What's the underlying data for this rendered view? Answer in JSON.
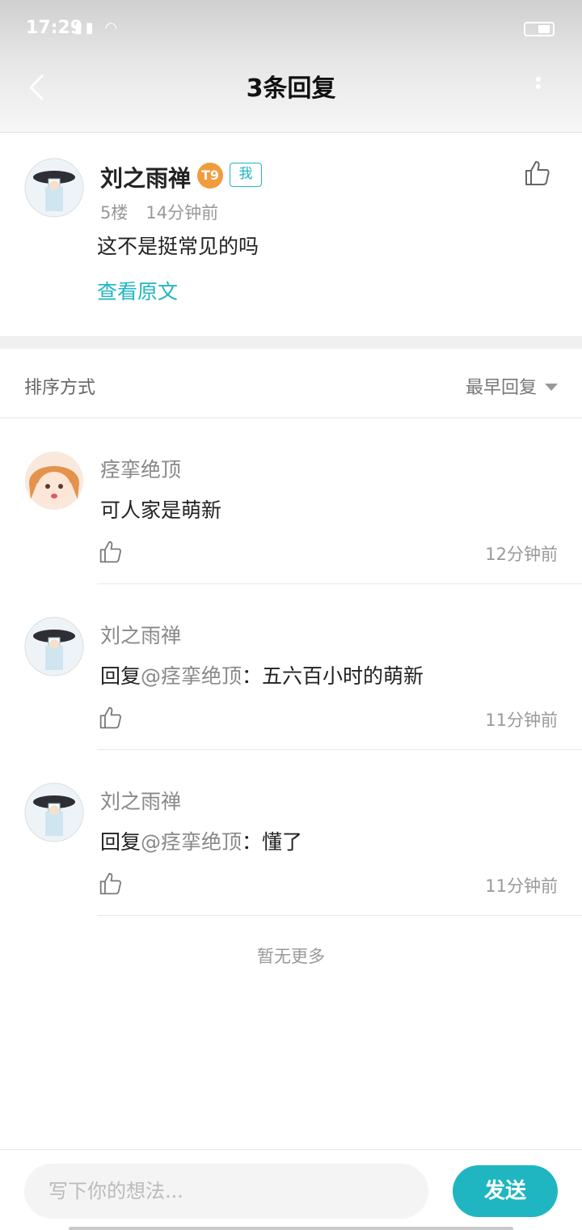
{
  "status_bar": {
    "time": "17:29",
    "icons": "signal wifi"
  },
  "header": {
    "title": "3条回复",
    "back_icon": "chevron-left-icon",
    "more_icon": "more-vertical-icon"
  },
  "main_post": {
    "username": "刘之雨禅",
    "level_badge": "T9",
    "me_badge": "我",
    "floor": "5楼",
    "time": "14分钟前",
    "text": "这不是挺常见的吗",
    "view_original": "查看原文",
    "like_icon": "thumbs-up-icon"
  },
  "sort": {
    "label": "排序方式",
    "selected": "最早回复"
  },
  "replies": [
    {
      "username": "痉挛绝顶",
      "prefix": "",
      "mention": "",
      "sep": "",
      "text": "可人家是萌新",
      "time": "12分钟前"
    },
    {
      "username": "刘之雨禅",
      "prefix": "回复",
      "mention": "@痉挛绝顶",
      "sep": "：",
      "text": "五六百小时的萌新",
      "time": "11分钟前"
    },
    {
      "username": "刘之雨禅",
      "prefix": "回复",
      "mention": "@痉挛绝顶",
      "sep": "：",
      "text": "懂了",
      "time": "11分钟前"
    }
  ],
  "no_more": "暂无更多",
  "composer": {
    "placeholder": "写下你的想法...",
    "send_label": "发送"
  },
  "colors": {
    "accent": "#1fb6c1",
    "badge_orange": "#f29b3b"
  }
}
